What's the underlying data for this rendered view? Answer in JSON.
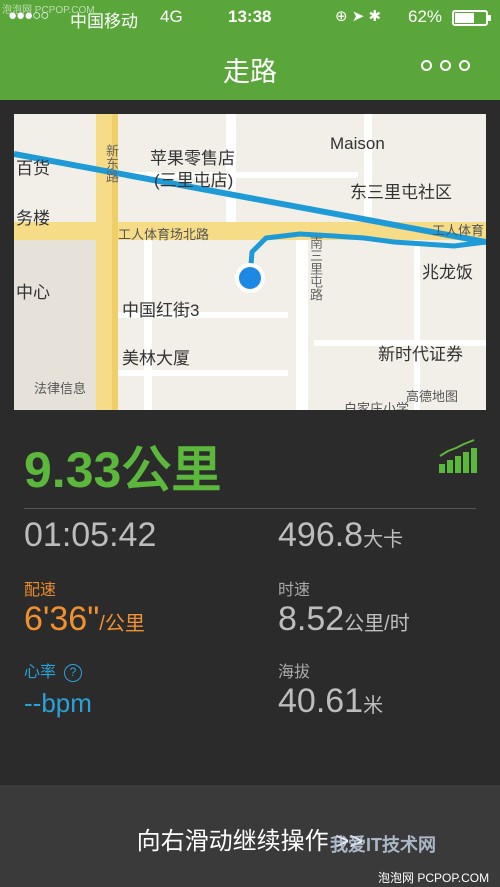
{
  "status_bar": {
    "watermark": "泡泡网 PCPOP.COM",
    "signal": "●●●○○",
    "carrier": "中国移动",
    "network": "4G",
    "time": "13:38",
    "icons": "⊕ ➤ ✱",
    "battery_pct": "62%",
    "battery_level": 0.62
  },
  "header": {
    "title": "走路",
    "more_icon": "more-dots-icon"
  },
  "map": {
    "labels": {
      "apple_store": "苹果零售店",
      "apple_store_sub": "(三里屯店)",
      "maison": "Maison",
      "dongsanli": "东三里屯社区",
      "baihuo": "百货",
      "wuloud": "务楼",
      "gongti_road": "工人体育场北路",
      "gongti_right": "工人体育",
      "zhaolong": "兆龙饭",
      "zhongxin": "中心",
      "hongjie": "中国红街3",
      "meilin": "美林大厦",
      "xinshidai": "新时代证券",
      "falv": "法律信息",
      "gaode": "高德地图",
      "nansanli": "南三里屯路",
      "xindong": "新东路",
      "baijia": "白家庄小学"
    }
  },
  "distance": "9.33公里",
  "stats": {
    "duration": "01:05:42",
    "calories_value": "496.8",
    "calories_unit": "大卡",
    "pace_label": "配速",
    "pace_value": "6'36\"",
    "pace_unit": "/公里",
    "speed_label": "时速",
    "speed_value": "8.52",
    "speed_unit": "公里/时",
    "heart_label": "心率",
    "heart_help": "?",
    "heart_value": "--bpm",
    "altitude_label": "海拔",
    "altitude_value": "40.61",
    "altitude_unit": "米"
  },
  "slide": {
    "text": "向右滑动继续操作 >>",
    "watermark": "我爱IT技术网",
    "watermark_sub": "泡泡网 PCPOP.COM"
  },
  "colors": {
    "header_green": "#5aa63a",
    "distance_green": "#5cb83c",
    "route_blue": "#1e9bd7",
    "pace_orange": "#f0912f",
    "heart_blue": "#2aa2d9"
  }
}
